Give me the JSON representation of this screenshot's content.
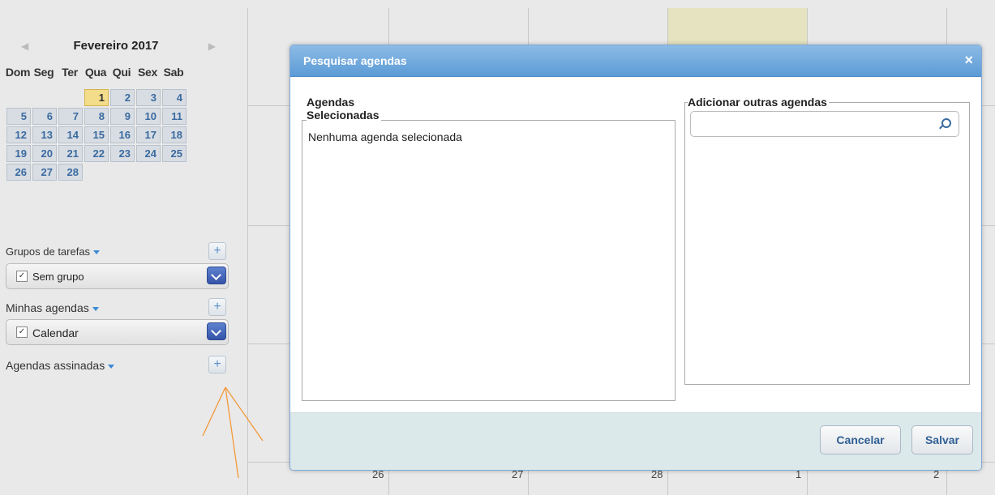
{
  "mini_calendar": {
    "prev_icon": "◀",
    "next_icon": "▶",
    "title": "Fevereiro 2017",
    "weekdays": [
      "Dom",
      "Seg",
      "Ter",
      "Qua",
      "Qui",
      "Sex",
      "Sab"
    ],
    "weeks": [
      [
        "",
        "",
        "",
        "1",
        "2",
        "3",
        "4"
      ],
      [
        "5",
        "6",
        "7",
        "8",
        "9",
        "10",
        "11"
      ],
      [
        "12",
        "13",
        "14",
        "15",
        "16",
        "17",
        "18"
      ],
      [
        "19",
        "20",
        "21",
        "22",
        "23",
        "24",
        "25"
      ],
      [
        "26",
        "27",
        "28",
        "",
        "",
        "",
        ""
      ]
    ],
    "today": "1"
  },
  "task_groups": {
    "title": "Grupos de tarefas",
    "add_label": "+",
    "items": [
      {
        "label": "Sem grupo",
        "checked": "✓"
      }
    ]
  },
  "my_calendars": {
    "title": "Minhas agendas",
    "add_label": "+",
    "items": [
      {
        "label": "Calendar",
        "checked": "✓"
      }
    ]
  },
  "subscribed_calendars": {
    "title": "Agendas assinadas",
    "add_label": "+"
  },
  "calendar_bottom_numbers": [
    "26",
    "27",
    "28",
    "1",
    "2"
  ],
  "dialog": {
    "title": "Pesquisar agendas",
    "close_label": "×",
    "selected_legend_line1": "Agendas",
    "selected_legend_line2": "Selecionadas",
    "empty_message": "Nenhuma agenda selecionada",
    "add_legend": "Adicionar outras agendas",
    "search_value": "",
    "search_placeholder": "",
    "cancel_label": "Cancelar",
    "save_label": "Salvar"
  },
  "colors": {
    "accent": "#5c9bd6",
    "today_highlight": "#f3dc8a",
    "footer_bg": "#dce9ea",
    "annotation": "#f29a3a"
  }
}
